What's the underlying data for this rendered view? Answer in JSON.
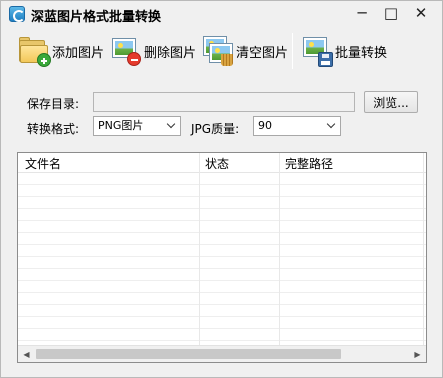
{
  "window": {
    "title": "深蓝图片格式批量转换",
    "minimize_glyph": "─",
    "maximize_glyph": "□",
    "close_glyph": "✕"
  },
  "toolbar": {
    "add_label": "添加图片",
    "delete_label": "删除图片",
    "clear_label": "清空图片",
    "batch_label": "批量转换",
    "icons": [
      "folder-add-icon",
      "picture-delete-icon",
      "picture-clear-icon",
      "picture-save-icon"
    ]
  },
  "form": {
    "save_dir_label": "保存目录:",
    "save_dir_value": "",
    "browse_label": "浏览...",
    "format_label": "转换格式:",
    "format_value": "PNG图片",
    "quality_label": "JPG质量:",
    "quality_value": "90"
  },
  "table": {
    "columns": [
      "文件名",
      "状态",
      "完整路径"
    ],
    "rows": []
  },
  "scrollbar": {
    "left_glyph": "◀",
    "right_glyph": "▶"
  }
}
